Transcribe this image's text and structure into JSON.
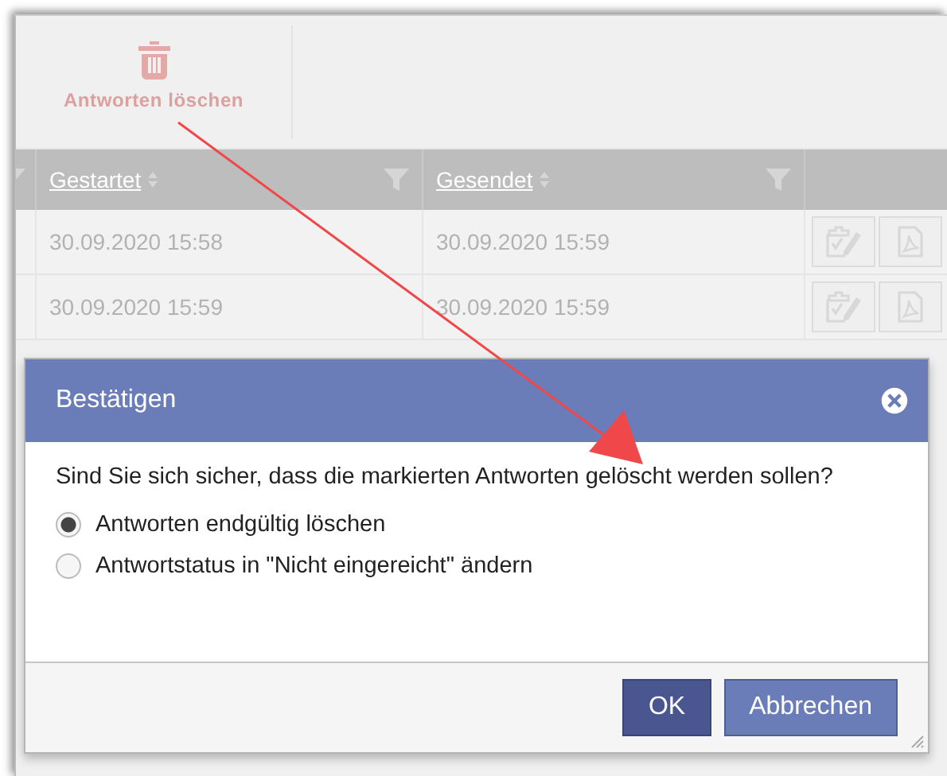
{
  "toolbar": {
    "buttons": [
      {
        "label": "Antworten löschen"
      }
    ]
  },
  "table": {
    "columns": [
      {
        "label": "Gestartet"
      },
      {
        "label": "Gesendet"
      }
    ],
    "rows": [
      {
        "cells": [
          "30.09.2020 15:58",
          "30.09.2020 15:59"
        ]
      },
      {
        "cells": [
          "30.09.2020 15:59",
          "30.09.2020 15:59"
        ]
      }
    ]
  },
  "dialog": {
    "title": "Bestätigen",
    "message": "Sind Sie sich sicher, dass die markierten Antworten gelöscht werden sollen?",
    "options": [
      {
        "label": "Antworten endgültig löschen",
        "selected": true
      },
      {
        "label": "Antwortstatus in \"Nicht eingereicht\" ändern",
        "selected": false
      }
    ],
    "buttons": [
      {
        "label": "OK",
        "kind": "primary"
      },
      {
        "label": "Abbrechen",
        "kind": "secondary"
      }
    ]
  }
}
